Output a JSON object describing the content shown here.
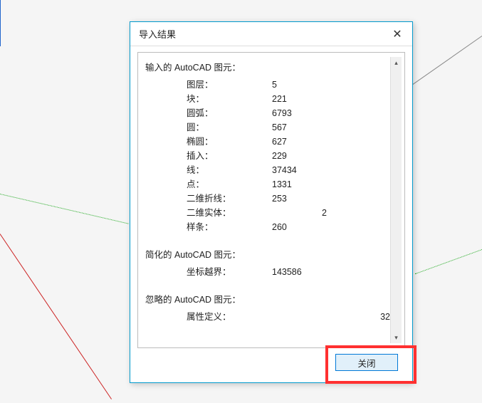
{
  "dialog": {
    "title": "导入结果",
    "close_btn_label": "关闭",
    "sections": {
      "imported": {
        "header": "输入的 AutoCAD 图元：",
        "rows": [
          {
            "label": "图层：",
            "value": "5"
          },
          {
            "label": "块：",
            "value": "221"
          },
          {
            "label": "圆弧：",
            "value": "6793"
          },
          {
            "label": "圆：",
            "value": "567"
          },
          {
            "label": "椭圆：",
            "value": "627"
          },
          {
            "label": "插入：",
            "value": "229"
          },
          {
            "label": "线：",
            "value": "37434"
          },
          {
            "label": "点：",
            "value": "1331"
          },
          {
            "label": "二维折线：",
            "value": "253"
          },
          {
            "label": "二维实体：",
            "value": "2"
          },
          {
            "label": "样条：",
            "value": "260"
          }
        ]
      },
      "simplified": {
        "header": "简化的 AutoCAD 图元：",
        "rows": [
          {
            "label": "坐标越界：",
            "value": "143586"
          }
        ]
      },
      "ignored": {
        "header": "忽略的 AutoCAD 图元：",
        "rows": [
          {
            "label": "属性定义：",
            "value": "32"
          }
        ]
      }
    }
  }
}
